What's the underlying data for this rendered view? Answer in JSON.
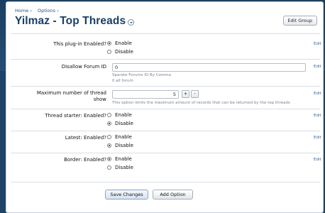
{
  "breadcrumb": {
    "items": [
      "Home ›",
      "Options ›"
    ]
  },
  "page": {
    "title": "Yilmaz - Top Threads",
    "edit_group_label": "Edit Group"
  },
  "edit_label": "Edit",
  "options": {
    "plugin_enabled": {
      "label": "This plug-in Enabled?",
      "choices": [
        "Enable",
        "Disable"
      ],
      "selected": "Enable"
    },
    "disallow_forum": {
      "label": "Disallow Forum ID",
      "value": "0",
      "hint1": "Sparate Forums ID By Comma",
      "hint2": "0 all forum"
    },
    "max_threads": {
      "label_line1": "Maximum number of thread",
      "label_line2": "show",
      "value": "5",
      "plus": "+",
      "minus": "-",
      "hint": "This option limits the maximum amount of records that can be returned by the top threads"
    },
    "thread_starter": {
      "label": "Thread starter: Enabled?",
      "choices": [
        "Enable",
        "Disable"
      ],
      "selected": "Disable"
    },
    "latest": {
      "label": "Latest: Enabled?",
      "choices": [
        "Enable",
        "Disable"
      ],
      "selected": "Disable"
    },
    "border": {
      "label": "Border: Enabled?",
      "choices": [
        "Enable",
        "Disable"
      ],
      "selected": "Enable"
    }
  },
  "buttons": {
    "save": "Save Changes",
    "add": "Add Option"
  }
}
